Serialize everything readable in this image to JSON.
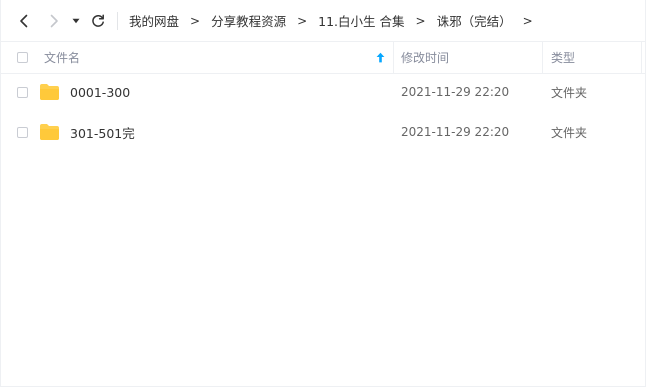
{
  "toolbar": {
    "back_icon": "chevron-left-icon",
    "forward_icon": "chevron-right-icon",
    "history_icon": "caret-down-icon",
    "refresh_icon": "refresh-icon"
  },
  "breadcrumb": [
    "我的网盘",
    "分享教程资源",
    "11.白小生 合集",
    "诛邪（完结）"
  ],
  "breadcrumb_separator": ">",
  "table": {
    "columns": {
      "name": "文件名",
      "modified": "修改时间",
      "type": "类型"
    },
    "sort_icon": "sort-ascending-arrow-icon",
    "rows": [
      {
        "name": "0001-300",
        "modified": "2021-11-29 22:20",
        "type": "文件夹"
      },
      {
        "name": "301-501完",
        "modified": "2021-11-29 22:20",
        "type": "文件夹"
      }
    ]
  },
  "colors": {
    "accent": "#06a7ff",
    "folder": "#ffd04e",
    "header_text": "#878c9c"
  }
}
